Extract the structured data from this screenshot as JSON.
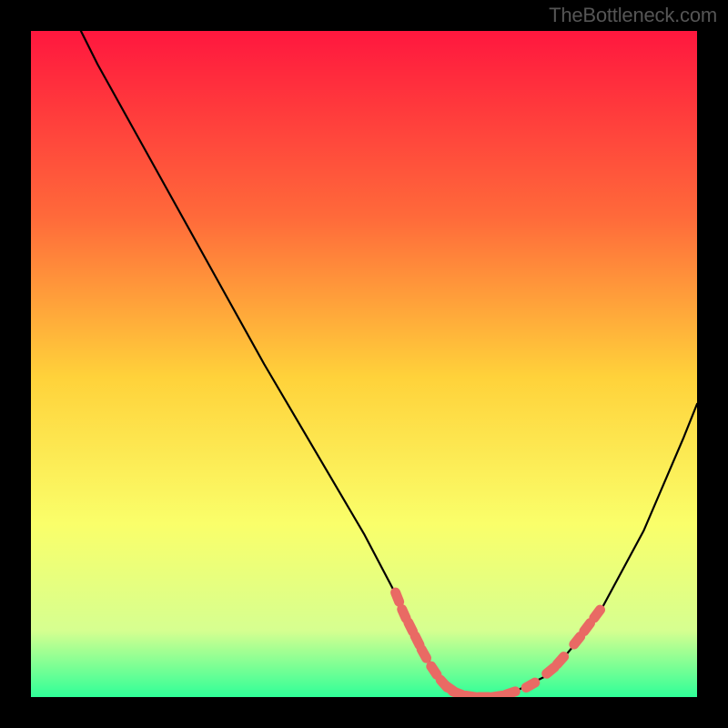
{
  "attribution": "TheBottleneck.com",
  "colors": {
    "background": "#000000",
    "gradient_top": "#ff173e",
    "gradient_mid_upper": "#ff6a3a",
    "gradient_mid": "#ffd23a",
    "gradient_mid_lower": "#faff6a",
    "gradient_lower": "#d6ff90",
    "gradient_bottom": "#2fff98",
    "curve": "#000000",
    "marker": "#e96a64"
  },
  "chart_data": {
    "type": "line",
    "title": "",
    "xlabel": "",
    "ylabel": "",
    "xlim": [
      0,
      100
    ],
    "ylim": [
      0,
      100
    ],
    "series": [
      {
        "name": "bottleneck-curve",
        "x": [
          7.5,
          10,
          15,
          20,
          25,
          30,
          35,
          40,
          45,
          50,
          55,
          56,
          57,
          58,
          59,
          60,
          61,
          62,
          63,
          64,
          65,
          68,
          72,
          78,
          85,
          92,
          98,
          100
        ],
        "y": [
          100,
          95,
          86,
          77,
          68,
          59,
          50,
          41.5,
          33,
          24.5,
          15,
          13,
          11,
          9,
          7,
          5,
          3.5,
          2.2,
          1.3,
          0.7,
          0.2,
          0,
          0.5,
          3.5,
          12,
          25,
          39,
          44
        ]
      }
    ],
    "markers": {
      "name": "highlighted-segments",
      "points": [
        {
          "x": 55.0,
          "y": 15.0
        },
        {
          "x": 56.0,
          "y": 12.5
        },
        {
          "x": 57.0,
          "y": 10.5
        },
        {
          "x": 58.0,
          "y": 8.5
        },
        {
          "x": 59.0,
          "y": 6.5
        },
        {
          "x": 60.5,
          "y": 4.0
        },
        {
          "x": 62.0,
          "y": 2.0
        },
        {
          "x": 63.0,
          "y": 1.2
        },
        {
          "x": 64.0,
          "y": 0.6
        },
        {
          "x": 66.0,
          "y": 0.1
        },
        {
          "x": 68.0,
          "y": 0.0
        },
        {
          "x": 70.0,
          "y": 0.1
        },
        {
          "x": 72.0,
          "y": 0.6
        },
        {
          "x": 75.0,
          "y": 1.8
        },
        {
          "x": 78.0,
          "y": 4.0
        },
        {
          "x": 79.5,
          "y": 5.5
        },
        {
          "x": 82.0,
          "y": 8.5
        },
        {
          "x": 83.5,
          "y": 10.5
        },
        {
          "x": 85.0,
          "y": 12.5
        }
      ]
    }
  }
}
